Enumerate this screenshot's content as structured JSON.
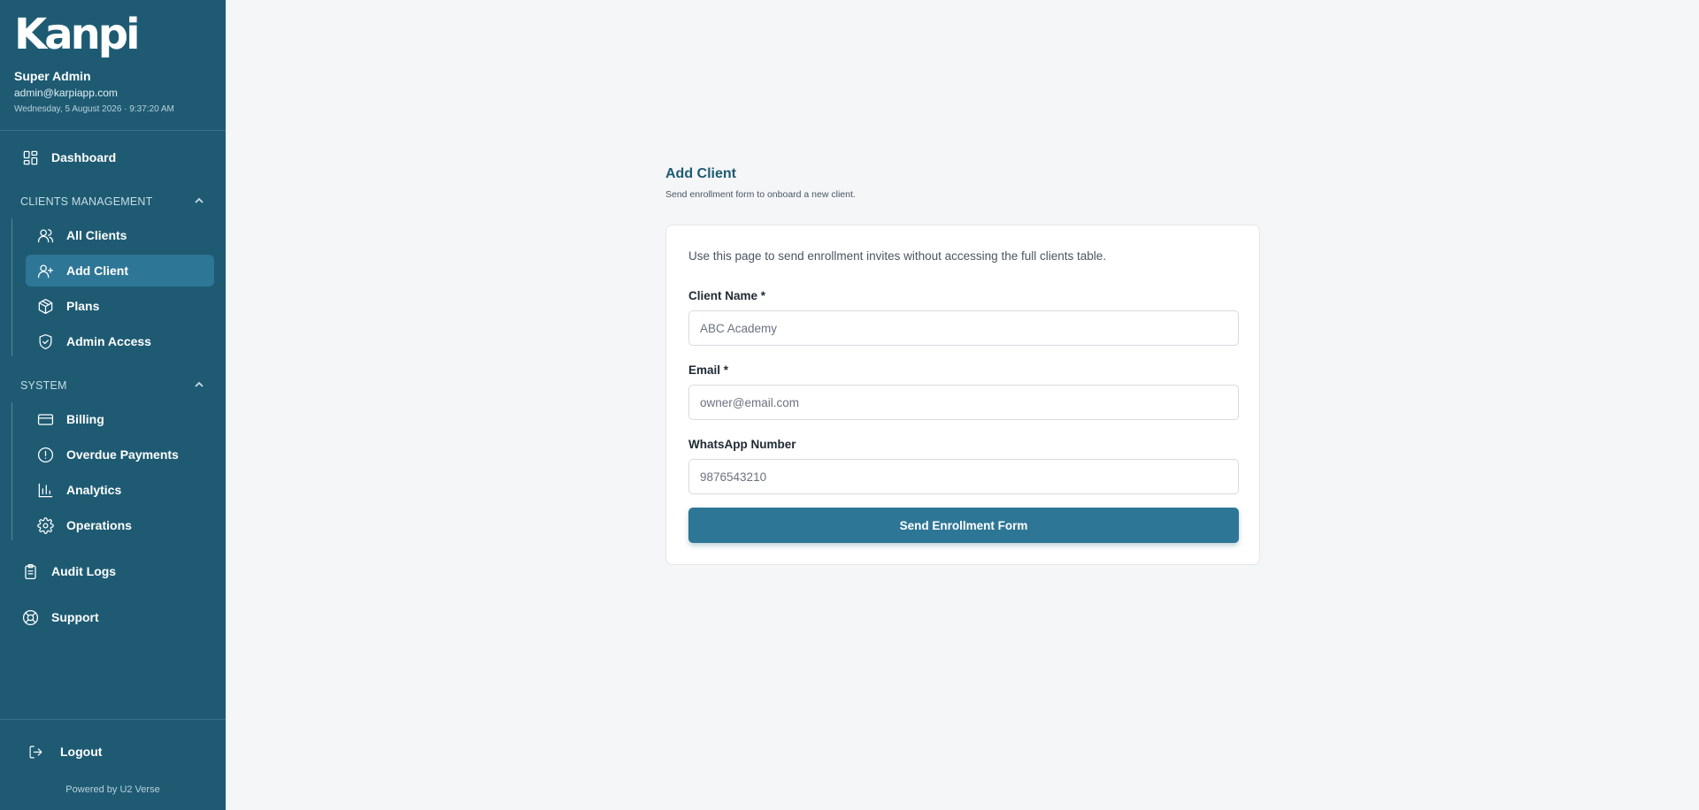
{
  "brand": {
    "logo_text": "Kanpi"
  },
  "user": {
    "name": "Super Admin",
    "email": "admin@karpiapp.com",
    "datetime": "Wednesday, 5 August 2026 · 9:37:20 AM"
  },
  "sidebar": {
    "dashboard": {
      "label": "Dashboard",
      "icon": "dashboard-icon"
    },
    "clients_section": {
      "title": "CLIENTS MANAGEMENT",
      "items": [
        {
          "label": "All Clients",
          "icon": "users-icon",
          "active": false
        },
        {
          "label": "Add Client",
          "icon": "user-plus-icon",
          "active": true
        },
        {
          "label": "Plans",
          "icon": "package-icon",
          "active": false
        },
        {
          "label": "Admin Access",
          "icon": "shield-check-icon",
          "active": false
        }
      ]
    },
    "system_section": {
      "title": "SYSTEM",
      "items": [
        {
          "label": "Billing",
          "icon": "credit-card-icon"
        },
        {
          "label": "Overdue Payments",
          "icon": "alert-circle-icon"
        },
        {
          "label": "Analytics",
          "icon": "bar-chart-icon"
        },
        {
          "label": "Operations",
          "icon": "gear-icon"
        }
      ]
    },
    "audit_logs": {
      "label": "Audit Logs",
      "icon": "clipboard-icon"
    },
    "support": {
      "label": "Support",
      "icon": "life-buoy-icon"
    },
    "logout": {
      "label": "Logout",
      "icon": "logout-icon"
    },
    "powered_by": "Powered by U2 Verse"
  },
  "page": {
    "title": "Add Client",
    "subtitle": "Send enrollment form to onboard a new client."
  },
  "form": {
    "intro": "Use this page to send enrollment invites without accessing the full clients table.",
    "client_name": {
      "label": "Client Name *",
      "value": "",
      "placeholder": "ABC Academy"
    },
    "email": {
      "label": "Email *",
      "value": "",
      "placeholder": "owner@email.com"
    },
    "whatsapp": {
      "label": "WhatsApp Number",
      "value": "",
      "placeholder": "9876543210"
    },
    "submit_label": "Send Enrollment Form"
  },
  "colors": {
    "sidebar_bg": "#1e5b73",
    "active_item_bg": "#2e7696",
    "primary_button": "#2e7696",
    "page_bg": "#f5f6f8",
    "title_color": "#1e5b73"
  }
}
